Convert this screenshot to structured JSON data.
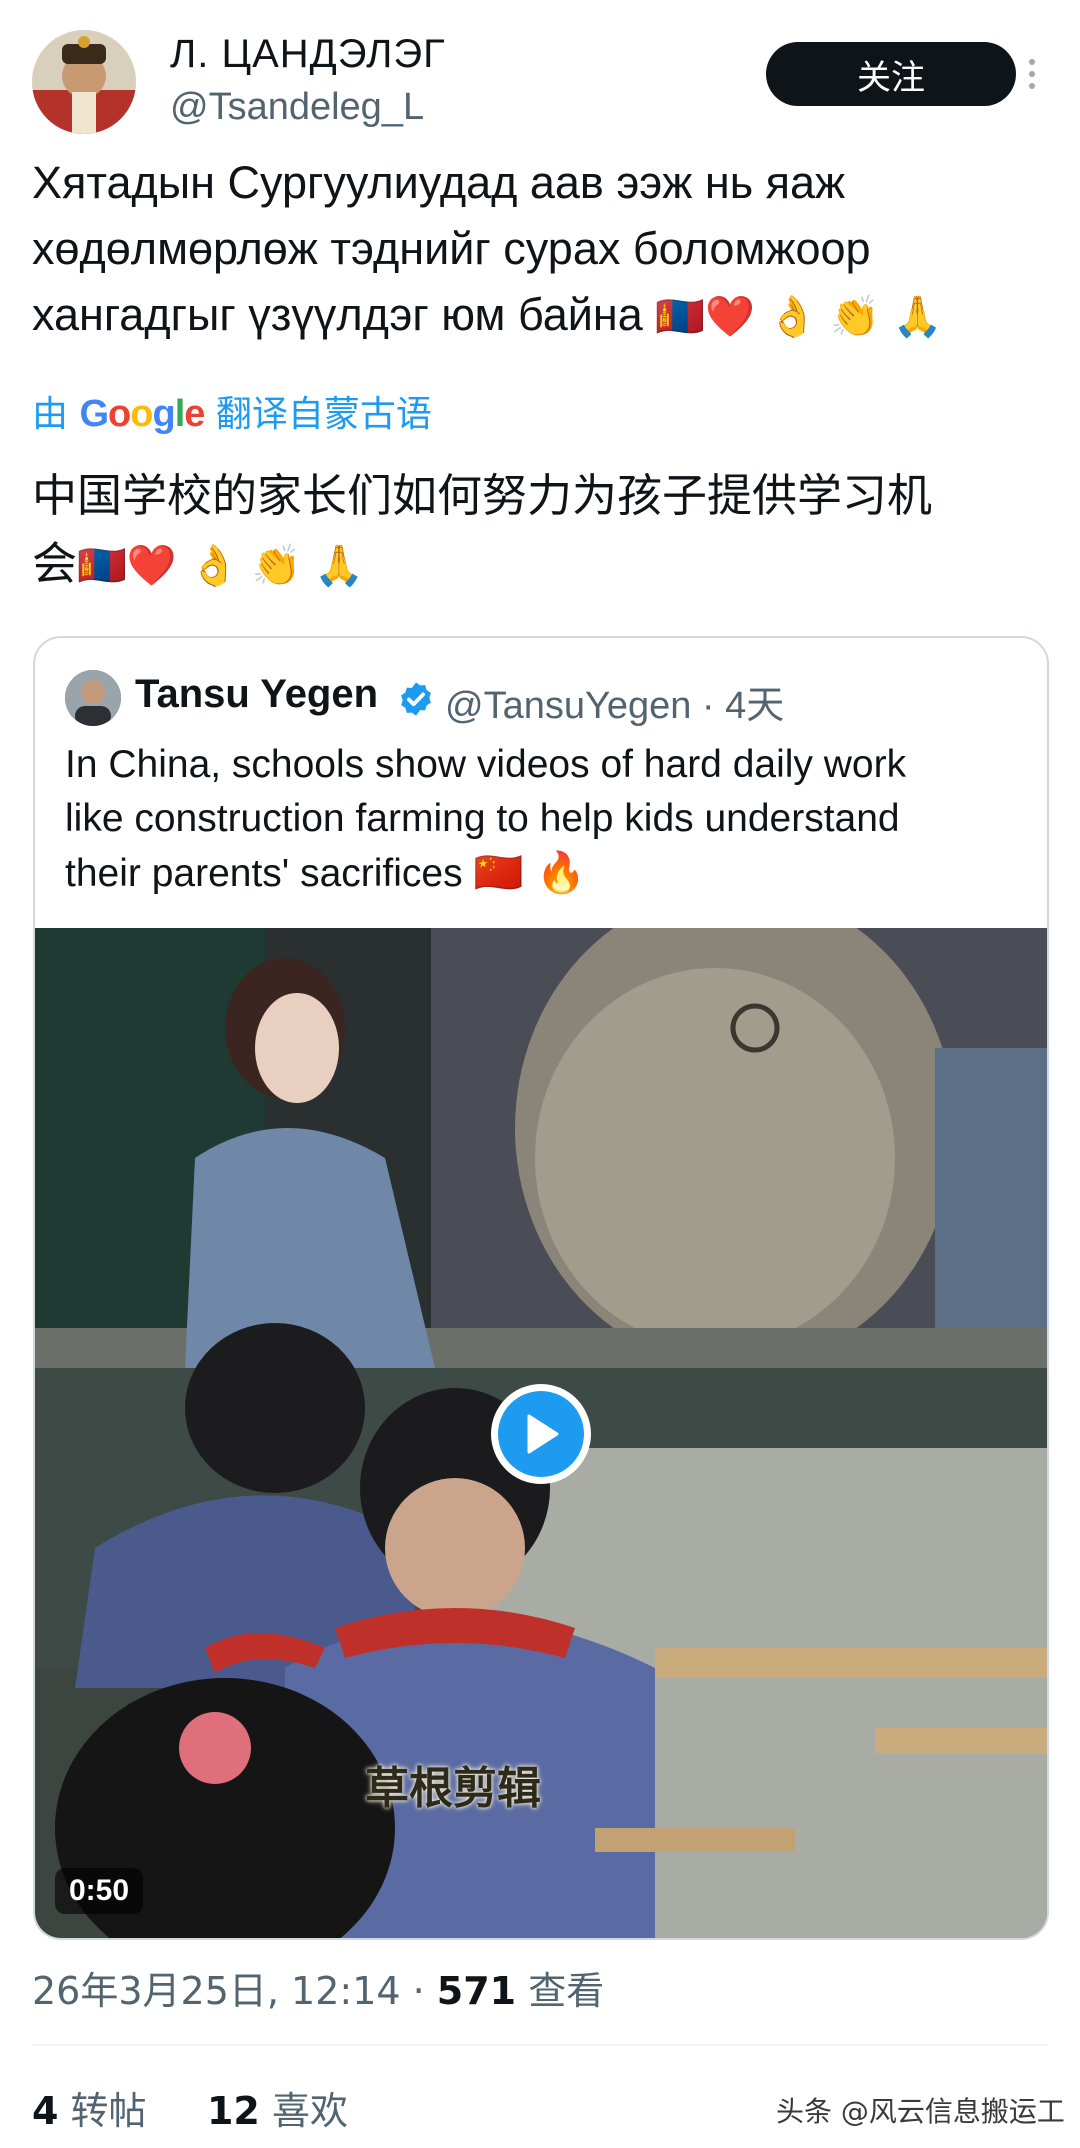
{
  "post": {
    "author_name": "Л. ЦАНДЭЛЭГ",
    "author_handle": "@Tsandeleg_L",
    "follow_label": "关注",
    "text_line1": "Хятадын Сургуулиудад аав ээж нь яаж",
    "text_line2": "хөдөлмөрлөж тэднийг сурах боломжоор",
    "text_line3": "хангадгыг үзүүлдэг юм байна",
    "text_emojis": "🇲🇳❤️ 👌 👏 🙏",
    "translate_prefix": "由",
    "translate_suffix": "翻译自蒙古语",
    "translated_line1": "中国学校的家长们如何努力为孩子提供学习机",
    "translated_line2": "会",
    "translated_emojis": "🇲🇳❤️ 👌 👏 🙏"
  },
  "quote": {
    "author_name": "Tansu Yegen",
    "author_handle": "@TansuYegen · 4天",
    "text_line1": "In China, schools show videos of hard daily work",
    "text_line2": "like construction farming to help kids understand",
    "text_line3": "their parents' sacrifices",
    "text_emojis": "🇨🇳 🔥",
    "video_duration": "0:50",
    "video_subtitle": "草根剪辑"
  },
  "meta": {
    "timestamp": "26年3月25日, 12:14 · ",
    "views_count": "571",
    "views_label": " 查看"
  },
  "stats": {
    "reposts_count": "4",
    "reposts_label": "转帖",
    "likes_count": "12",
    "likes_label": "喜欢"
  },
  "watermark": "头条 @风云信息搬运工",
  "colors": {
    "accent": "#1d9bf0",
    "text": "#0f1419",
    "secondary": "#536471",
    "follow_bg": "#0f1419"
  }
}
